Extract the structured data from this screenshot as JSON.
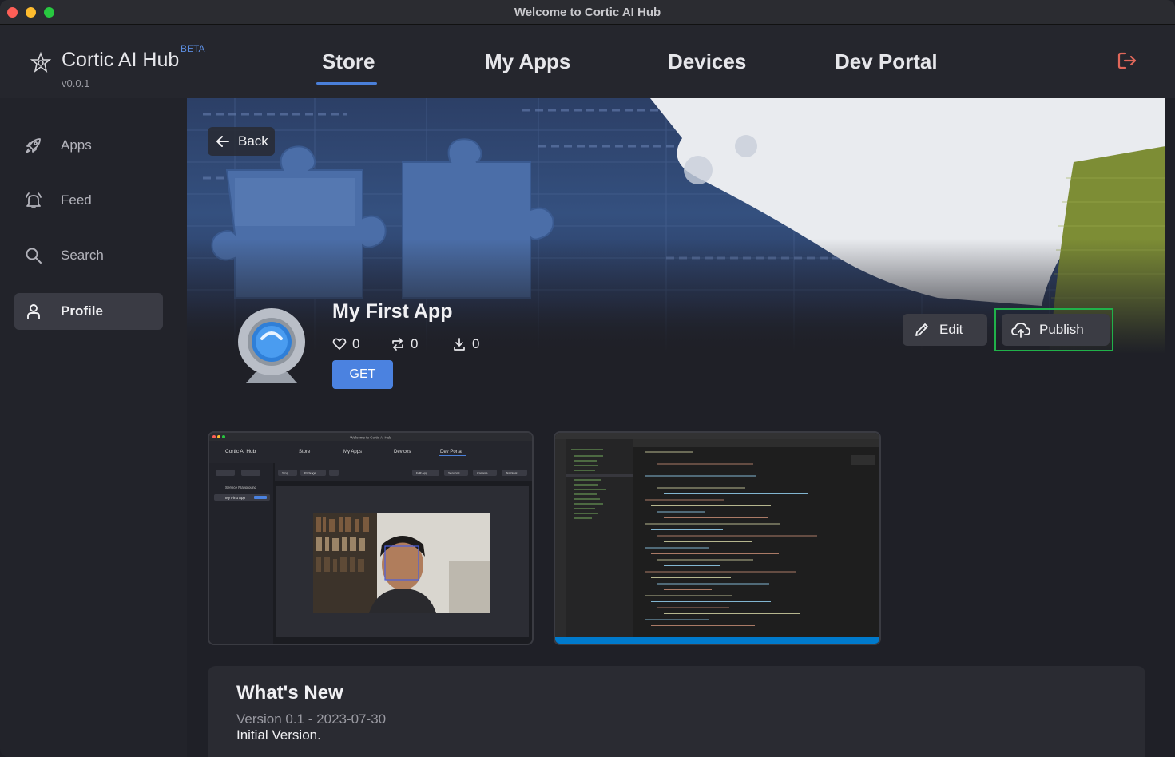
{
  "window": {
    "title": "Welcome to Cortic AI Hub"
  },
  "brand": {
    "name": "Cortic AI Hub",
    "badge": "BETA",
    "version": "v0.0.1"
  },
  "nav": {
    "tabs": [
      "Store",
      "My Apps",
      "Devices",
      "Dev Portal"
    ],
    "active": "Store"
  },
  "sidebar": {
    "items": [
      {
        "label": "Apps",
        "icon": "rocket-icon"
      },
      {
        "label": "Feed",
        "icon": "bell-icon"
      },
      {
        "label": "Search",
        "icon": "search-icon"
      },
      {
        "label": "Profile",
        "icon": "user-icon"
      }
    ],
    "active": "Profile"
  },
  "app": {
    "back_label": "Back",
    "name": "My First App",
    "likes": "0",
    "reposts": "0",
    "downloads": "0",
    "get_label": "GET",
    "edit_label": "Edit",
    "publish_label": "Publish"
  },
  "screenshots": {
    "shot1": {
      "title": "Welcome to Cortic AI Hub",
      "brand": "Cortic AI Hub",
      "tabs": [
        "Store",
        "My Apps",
        "Devices",
        "Dev Portal"
      ],
      "side_items": [
        "Service Playground",
        "My First App"
      ],
      "toolbar": [
        "Stop",
        "Package",
        "Edit App",
        "Services",
        "Camera",
        "Terminal"
      ]
    }
  },
  "whats_new": {
    "title": "What's New",
    "version_line": "Version 0.1 - 2023-07-30",
    "notes": "Initial Version."
  },
  "colors": {
    "accent": "#4b82e0",
    "highlight": "#20b14a",
    "logout": "#e0675a"
  }
}
